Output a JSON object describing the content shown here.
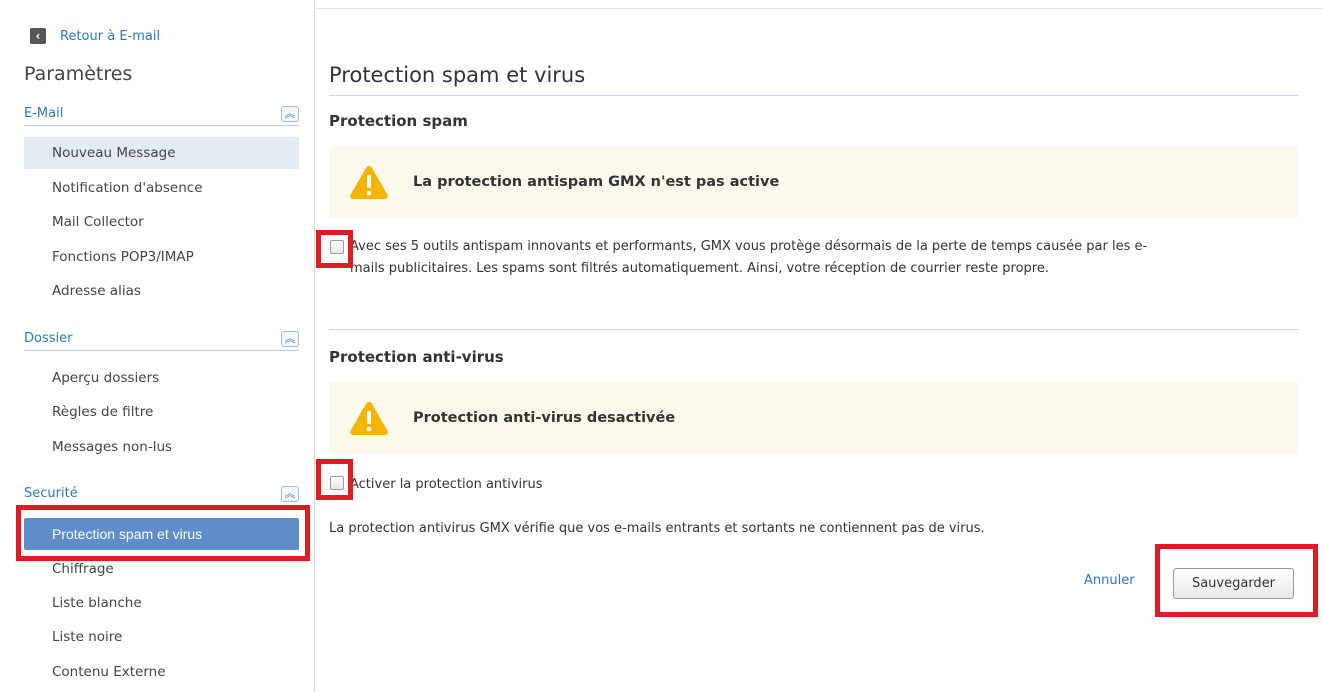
{
  "sidebar": {
    "back_label": "Retour à E-mail",
    "title": "Paramètres",
    "sections": [
      {
        "label": "E-Mail",
        "items": [
          "Nouveau Message",
          "Notification d'absence",
          "Mail Collector",
          "Fonctions POP3/IMAP",
          "Adresse alias"
        ]
      },
      {
        "label": "Dossier",
        "items": [
          "Aperçu dossiers",
          "Règles de filtre",
          "Messages non-lus"
        ]
      },
      {
        "label": "Securité",
        "items": [
          "Protection spam et virus",
          "Chiffrage",
          "Liste blanche",
          "Liste noire",
          "Contenu Externe"
        ]
      }
    ],
    "active_item": "Protection spam et virus",
    "hover_item": "Nouveau Message"
  },
  "main": {
    "title": "Protection spam et virus",
    "spam": {
      "title": "Protection spam",
      "warning": "La protection antispam GMX n'est pas active",
      "checkbox_text_line1": "Avec ses 5 outils antispam innovants et performants, GMX vous protège désormais de la perte de temps causée par les e-",
      "checkbox_text_line2": "mails publicitaires. Les spams sont filtrés automatiquement. Ainsi, votre réception de courrier reste propre.",
      "checked": false
    },
    "virus": {
      "title": "Protection anti-virus",
      "warning": "Protection anti-virus desactivée",
      "checkbox_label": "Activer la protection antivirus",
      "checked": false,
      "description": "La protection antivirus GMX vérifie que vos e-mails entrants et sortants ne contiennent pas de virus."
    },
    "cancel_label": "Annuler",
    "save_label": "Sauvegarder"
  },
  "colors": {
    "accent": "#2e76bd",
    "active_nav": "#5e8dc9",
    "warning_bg": "#fbf8ec",
    "warning_icon": "#f5b400",
    "highlight_box": "#e01b25"
  },
  "icons": {
    "back": "chevron-left-icon",
    "collapse": "double-chevron-up-icon",
    "warning": "warning-triangle-icon"
  }
}
